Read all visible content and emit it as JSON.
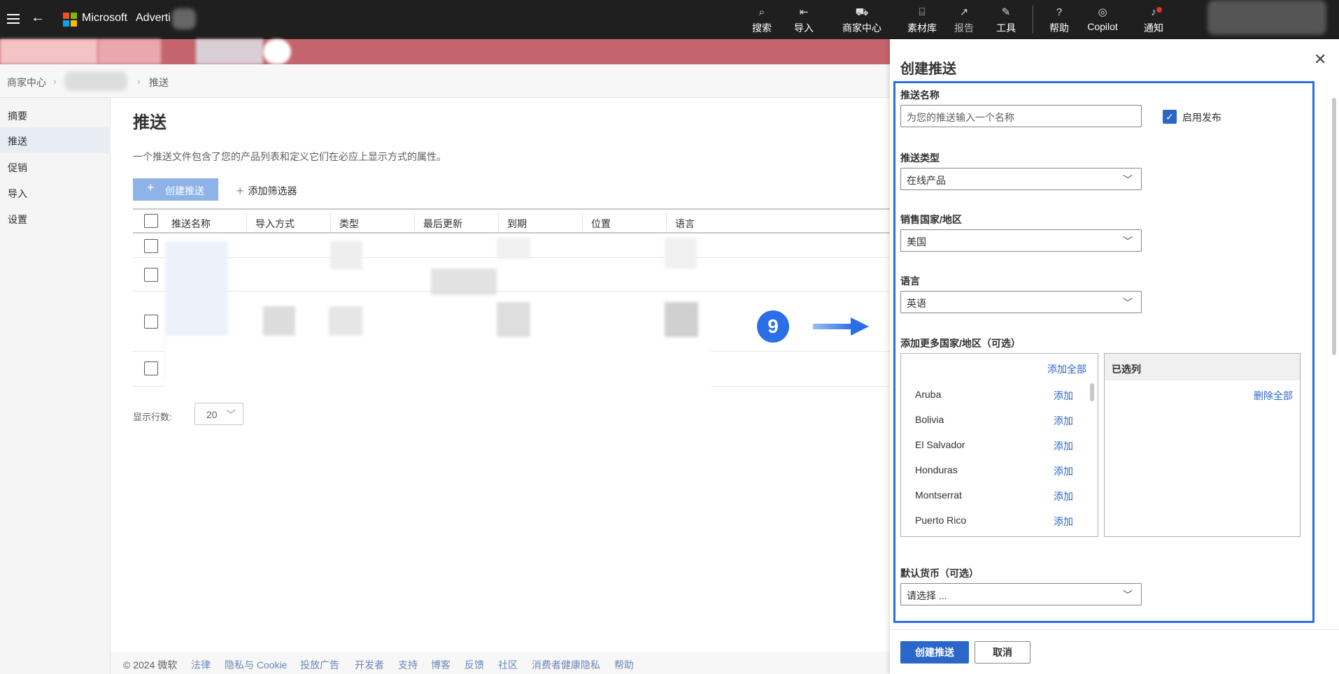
{
  "topbar": {
    "brand": "Microsoft",
    "brand_suffix": "Adverti",
    "nav": [
      {
        "icon": "search-icon",
        "glyph": "⌕",
        "label": "搜索"
      },
      {
        "icon": "import-icon",
        "glyph": "⇤",
        "label": "导入"
      },
      {
        "icon": "cart-icon",
        "glyph": "🛒",
        "label": "商家中心"
      },
      {
        "icon": "asset-library-icon",
        "glyph": "⌸",
        "label": "素材库"
      },
      {
        "icon": "report-icon",
        "glyph": "↗",
        "label": "报告"
      },
      {
        "icon": "wrench-icon",
        "glyph": "✎",
        "label": "工具"
      },
      {
        "icon": "help-icon",
        "glyph": "?",
        "label": "帮助"
      },
      {
        "icon": "copilot-icon",
        "glyph": "◎",
        "label": "Copilot"
      },
      {
        "icon": "bell-icon",
        "glyph": "🔔",
        "label": "通知"
      }
    ]
  },
  "breadcrumb": {
    "root": "商家中心",
    "current": "推送"
  },
  "sidebar": {
    "items": [
      "摘要",
      "推送",
      "促销",
      "导入",
      "设置"
    ],
    "active_index": 1
  },
  "main": {
    "title": "推送",
    "description": "一个推送文件包含了您的产品列表和定义它们在必应上显示方式的属性。",
    "create_button": "创建推送",
    "add_filter": "添加筛选器",
    "columns": [
      "推送名称",
      "导入方式",
      "类型",
      "最后更新",
      "到期",
      "位置",
      "语言"
    ],
    "rows_label": "显示行数:",
    "rows_value": "20"
  },
  "footer": {
    "copyright": "© 2024 微软",
    "links": [
      "法律",
      "隐私与 Cookie",
      "投放广告",
      "开发者",
      "支持",
      "博客",
      "反馈",
      "社区",
      "消费者健康隐私",
      "帮助"
    ]
  },
  "annotation": {
    "step": "9"
  },
  "panel": {
    "title": "创建推送",
    "name_label": "推送名称",
    "name_placeholder": "为您的推送输入一个名称",
    "enable_publish": "启用发布",
    "enable_publish_checked": true,
    "type_label": "推送类型",
    "type_value": "在线产品",
    "country_label": "销售国家/地区",
    "country_value": "美国",
    "language_label": "语言",
    "language_value": "英语",
    "more_countries_label": "添加更多国家/地区（可选）",
    "add_all": "添加全部",
    "add_label": "添加",
    "countries": [
      "Aruba",
      "Bolivia",
      "El Salvador",
      "Honduras",
      "Montserrat",
      "Puerto Rico"
    ],
    "selected_header": "已选列",
    "remove_all": "删除全部",
    "currency_label": "默认货币（可选）",
    "currency_placeholder": "请选择 ...",
    "create_button": "创建推送",
    "cancel_button": "取消"
  },
  "colors": {
    "topbar": "#1f1f1f",
    "accent": "#2b66c9",
    "highlight": "#2a6ee8",
    "banner": "#c4646c"
  }
}
